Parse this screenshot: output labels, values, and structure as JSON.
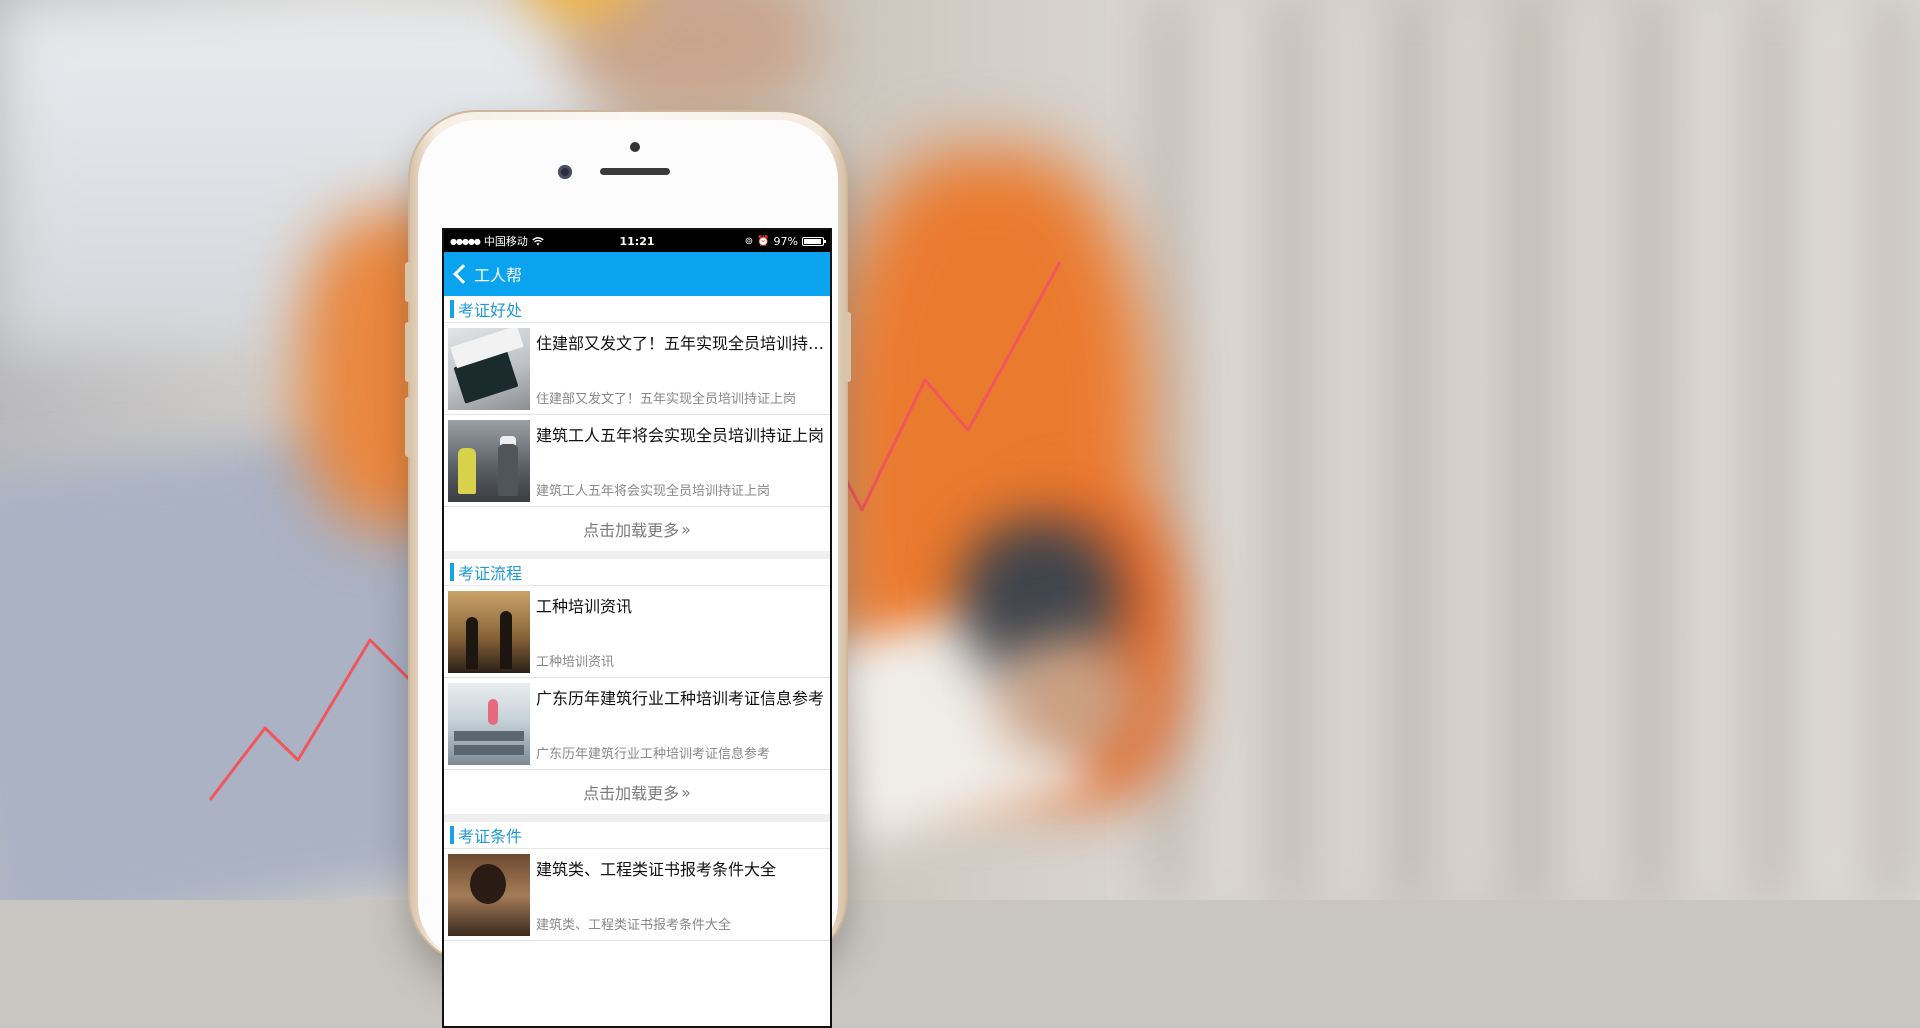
{
  "statusbar": {
    "signal": "●●●●●",
    "carrier": "中国移动",
    "wifi_icon": "wifi-icon",
    "time": "11:21",
    "battery_percent": "97%",
    "battery_level": 0.97
  },
  "navbar": {
    "back_icon": "chevron-left-icon",
    "title": "工人帮"
  },
  "sections": [
    {
      "title": "考证好处",
      "items": [
        {
          "title": "住建部又发文了！五年实现全员培训持证上岗",
          "subtitle": "住建部又发文了！五年实现全员培训持证上岗",
          "thumb": "book"
        },
        {
          "title": "建筑工人五年将会实现全员培训持证上岗",
          "subtitle": "建筑工人五年将会实现全员培训持证上岗",
          "thumb": "workers"
        }
      ],
      "load_more": "点击加载更多",
      "load_more_icon": "»"
    },
    {
      "title": "考证流程",
      "items": [
        {
          "title": "工种培训资讯",
          "subtitle": "工种培训资讯",
          "thumb": "site"
        },
        {
          "title": "广东历年建筑行业工种培训考证信息参考",
          "subtitle": "广东历年建筑行业工种培训考证信息参考",
          "thumb": "class"
        }
      ],
      "load_more": "点击加载更多",
      "load_more_icon": "»"
    },
    {
      "title": "考证条件",
      "items": [
        {
          "title": "建筑类、工程类证书报考条件大全",
          "subtitle": "建筑类、工程类证书报考条件大全",
          "thumb": "study"
        }
      ]
    }
  ],
  "colors": {
    "accent": "#0aa3f0",
    "section_title": "#1f9ad8",
    "trend_line": "#f0565b"
  }
}
